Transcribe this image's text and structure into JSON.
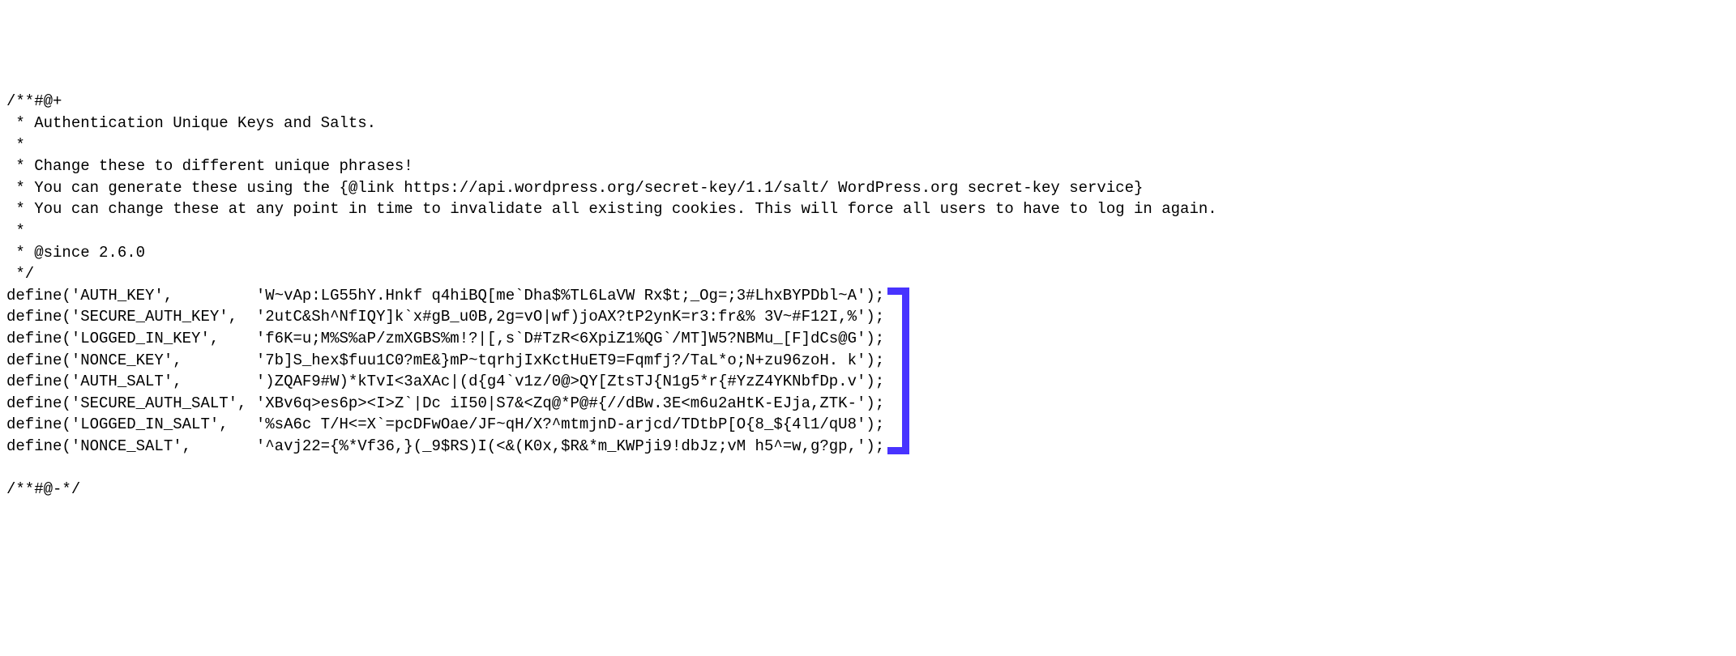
{
  "comment": {
    "l1": "/**#@+",
    "l2": " * Authentication Unique Keys and Salts.",
    "l3": " *",
    "l4": " * Change these to different unique phrases!",
    "l5": " * You can generate these using the {@link https://api.wordpress.org/secret-key/1.1/salt/ WordPress.org secret-key service}",
    "l6": " * You can change these at any point in time to invalidate all existing cookies. This will force all users to have to log in again.",
    "l7": " *",
    "l8": " * @since 2.6.0",
    "l9": " */"
  },
  "defines": [
    {
      "key": "define('AUTH_KEY',         ",
      "val": "'W~vAp:LG55hY.Hnkf q4hiBQ[me`Dha$%TL6LaVW Rx$t;_Og=;3#LhxBYPDbl~A');"
    },
    {
      "key": "define('SECURE_AUTH_KEY',  ",
      "val": "'2utC&Sh^NfIQY]k`x#gB_u0B,2g=vO|wf)joAX?tP2ynK=r3:fr&% 3V~#F12I,%');"
    },
    {
      "key": "define('LOGGED_IN_KEY',    ",
      "val": "'f6K=u;M%S%aP/zmXGBS%m!?|[,s`D#TzR<6XpiZ1%QG`/MT]W5?NBMu_[F]dCs@G');"
    },
    {
      "key": "define('NONCE_KEY',        ",
      "val": "'7b]S_hex$fuu1C0?mE&}mP~tqrhjIxKctHuET9=Fqmfj?/TaL*o;N+zu96zoH. k');"
    },
    {
      "key": "define('AUTH_SALT',        ",
      "val": "')ZQAF9#W)*kTvI<3aXAc|(d{g4`v1z/0@>QY[ZtsTJ{N1g5*r{#YzZ4YKNbfDp.v');"
    },
    {
      "key": "define('SECURE_AUTH_SALT', ",
      "val": "'XBv6q>es6p><I>Z`|Dc iI50|S7&<Zq@*P@#{//dBw.3E<m6u2aHtK-EJja,ZTK-');"
    },
    {
      "key": "define('LOGGED_IN_SALT',   ",
      "val": "'%sA6c T/H<=X`=pcDFwOae/JF~qH/X?^mtmjnD-arjcd/TDtbP[O{8_${4l1/qU8');"
    },
    {
      "key": "define('NONCE_SALT',       ",
      "val": "'^avj22={%*Vf36,}(_9$RS)I(<&(K0x,$R&*m_KWPji9!dbJz;vM h5^=w,g?gp,');"
    }
  ],
  "footer": {
    "l1": "/**#@-*/"
  }
}
